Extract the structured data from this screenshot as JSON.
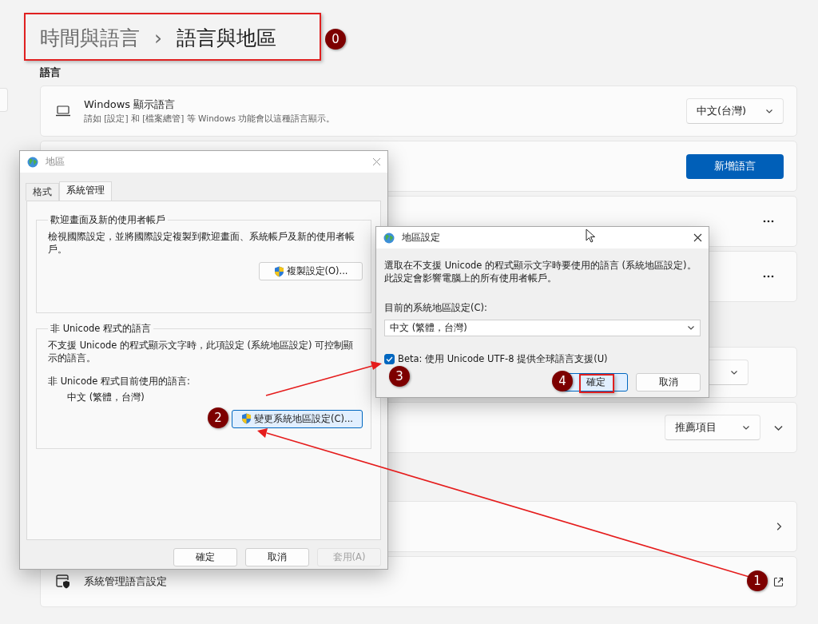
{
  "breadcrumb": {
    "parent": "時間與語言",
    "separator": "›",
    "current": "語言與地區"
  },
  "setting_groups": [
    {
      "title": "語言",
      "cards": [
        {
          "kind": "dropdown",
          "title": "Windows 顯示語言",
          "description": "請如 [設定] 和 [檔案總管] 等 Windows 功能會以這種語言顯示。",
          "value": "中文(台灣)"
        },
        {
          "kind": "button",
          "label": "新增語言"
        },
        {
          "kind": "more"
        },
        {
          "kind": "more"
        }
      ]
    },
    {
      "cards": [
        {
          "kind": "dropdown"
        },
        {
          "kind": "dropdown_expand",
          "value": "推薦項目"
        }
      ]
    },
    {
      "cards": [
        {
          "kind": "link"
        },
        {
          "kind": "external",
          "title": "系統管理語言設定"
        }
      ]
    }
  ],
  "region_dialog": {
    "title": "地區",
    "tabs": [
      {
        "label": "格式",
        "selected": false
      },
      {
        "label": "系統管理",
        "selected": true
      }
    ],
    "groups": [
      {
        "title": "歡迎畫面及新的使用者帳戶",
        "description": "檢視國際設定，並將國際設定複製到歡迎畫面、系統帳戶及新的使用者帳戶。",
        "button": {
          "label": "複製設定(O)...",
          "focused": false
        }
      },
      {
        "title": "非 Unicode 程式的語言",
        "description": "不支援 Unicode 的程式顯示文字時，此項設定 (系統地區設定) 可控制顯示的語言。",
        "current_label": "非 Unicode 程式目前使用的語言:",
        "current_value": "中文 (繁體，台灣)",
        "button": {
          "label": "變更系統地區設定(C)...",
          "focused": true
        }
      }
    ],
    "buttons": [
      {
        "label": "確定",
        "disabled": false
      },
      {
        "label": "取消",
        "disabled": false
      },
      {
        "label": "套用(A)",
        "disabled": true
      }
    ]
  },
  "locale_dialog": {
    "title": "地區設定",
    "description": "選取在不支援 Unicode 的程式顯示文字時要使用的語言 (系統地區設定)。此設定會影響電腦上的所有使用者帳戶。",
    "select_label": "目前的系統地區設定(C):",
    "select_value": "中文 (繁體，台灣)",
    "checkbox": {
      "label": "Beta: 使用 Unicode UTF-8 提供全球語言支援(U)",
      "checked": true
    },
    "buttons": [
      {
        "label": "確定",
        "default": true
      },
      {
        "label": "取消",
        "default": false
      }
    ]
  },
  "markers": [
    {
      "label": "0"
    },
    {
      "label": "1"
    },
    {
      "label": "2"
    },
    {
      "label": "3"
    },
    {
      "label": "4"
    }
  ]
}
